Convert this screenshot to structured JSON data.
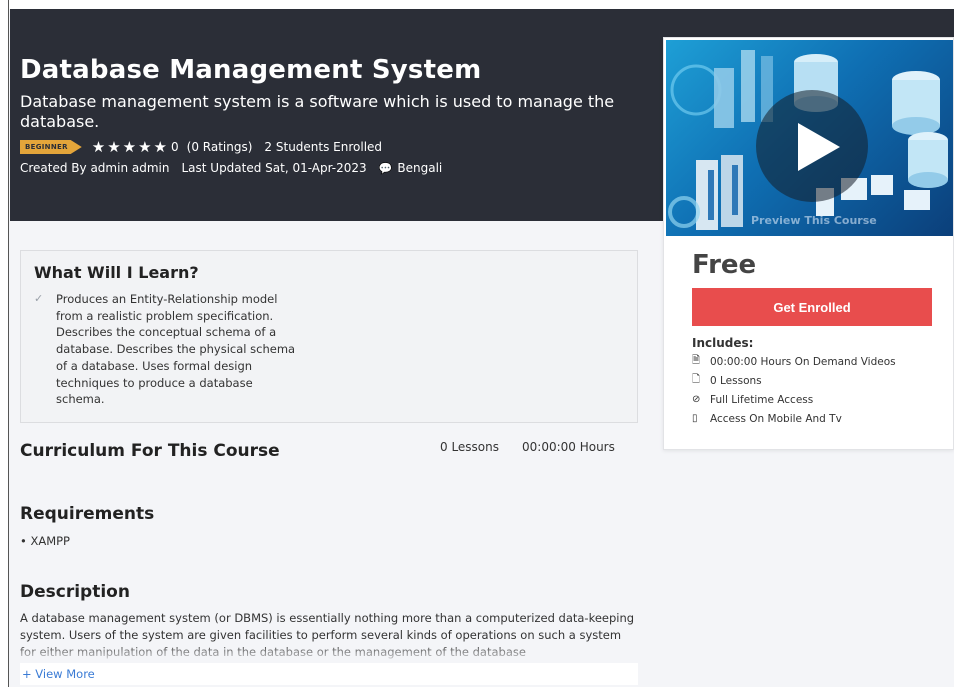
{
  "course": {
    "title": "Database Management System",
    "subtitle": "Database management system is a software which is used to manage the database.",
    "level_badge": "BEGINNER",
    "stars": "★★★★★",
    "rating_value": "0",
    "ratings_count": "(0 Ratings)",
    "students": "2 Students Enrolled",
    "created_by": "Created By admin admin",
    "last_updated": "Last Updated Sat, 01-Apr-2023",
    "language": "Bengali"
  },
  "learn": {
    "title": "What Will I Learn?",
    "items": [
      "Produces an Entity-Relationship model from a realistic problem specification. Describes the conceptual schema of a database. Describes the physical schema of a database. Uses formal design techniques to produce a database schema."
    ]
  },
  "curriculum": {
    "title": "Curriculum For This Course",
    "lessons": "0 Lessons",
    "hours": "00:00:00 Hours"
  },
  "requirements": {
    "title": "Requirements",
    "items": [
      "XAMPP"
    ]
  },
  "description": {
    "title": "Description",
    "text": "A database management system (or DBMS) is essentially nothing more than a computerized data-keeping system. Users of the system are given facilities to perform several kinds of operations on such a system for either manipulation of the data in the database or the management of the database",
    "view_more": "+ View More"
  },
  "sidebar": {
    "preview_label": "Preview This Course",
    "price": "Free",
    "enroll_button": "Get Enrolled",
    "includes_title": "Includes:",
    "includes": [
      {
        "icon": "document-icon",
        "label": "00:00:00 Hours On Demand Videos"
      },
      {
        "icon": "file-icon",
        "label": "0 Lessons"
      },
      {
        "icon": "compass-icon",
        "label": "Full Lifetime Access"
      },
      {
        "icon": "mobile-icon",
        "label": "Access On Mobile And Tv"
      }
    ]
  },
  "colors": {
    "header_bg": "#2b2e37",
    "badge": "#e4a53a",
    "enroll_button": "#e84d4d",
    "link": "#3a7bd5"
  }
}
